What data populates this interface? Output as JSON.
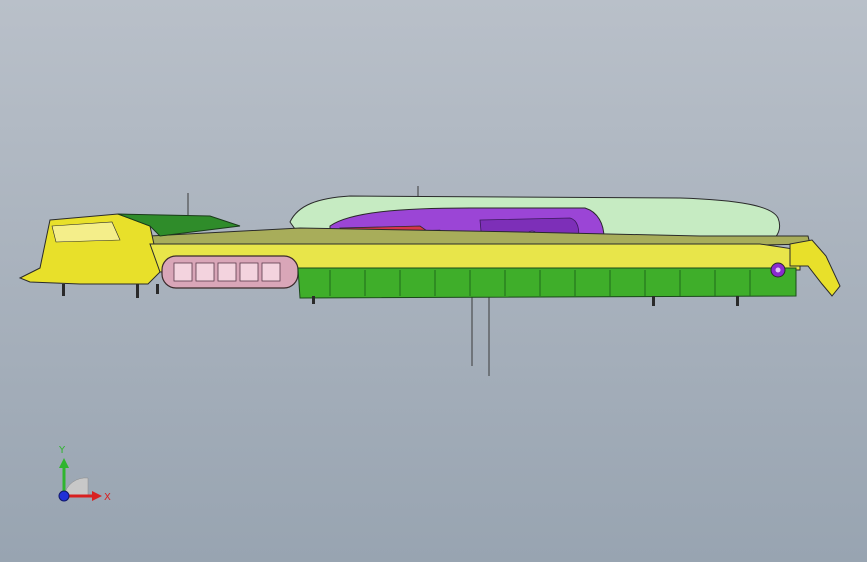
{
  "viewport": {
    "background_top": "#b9c0c9",
    "background_bottom": "#98a4b1"
  },
  "model": {
    "colors": {
      "yellow": "#e8e02a",
      "green": "#3fae2a",
      "dark_green": "#1f7a1a",
      "light_green": "#c8ecc4",
      "purple": "#9a3fd8",
      "pink": "#d9a6b8",
      "red": "#d62a3a",
      "olive": "#9aa04a",
      "outline": "#2a2a2a"
    }
  },
  "triad": {
    "y_label": "Y",
    "x_label": "X",
    "y_color": "#2fb52f",
    "x_color": "#d82020",
    "z_color": "#2030d8"
  }
}
